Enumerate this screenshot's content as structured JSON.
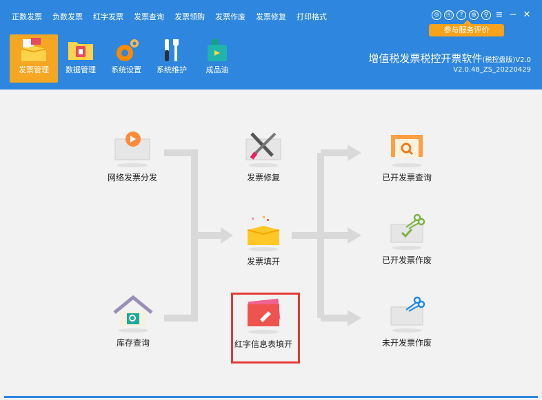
{
  "menu": [
    "正数发票",
    "负数发票",
    "红字发票",
    "发票查询",
    "发票领购",
    "发票作废",
    "发票修复",
    "打印格式"
  ],
  "window_controls": [
    "⊜",
    "ⓠ",
    "?",
    "⊕",
    "♀",
    "≡",
    "−",
    "✕"
  ],
  "feedback": "参与服务评价",
  "toolbar": [
    {
      "label": "发票管理",
      "icon": "invoice-box-icon"
    },
    {
      "label": "数据管理",
      "icon": "data-folder-icon"
    },
    {
      "label": "系统设置",
      "icon": "gear-icon"
    },
    {
      "label": "系统维护",
      "icon": "tools-icon"
    },
    {
      "label": "成品油",
      "icon": "oil-can-icon"
    }
  ],
  "app": {
    "title": "增值税发票税控开票软件",
    "edition": "(税控盘版)",
    "version_short": "V2.0",
    "version": "V2.0.48_ZS_20220429"
  },
  "flow": {
    "network_dispatch": "网络发票分发",
    "inventory_query": "库存查询",
    "invoice_repair": "发票修复",
    "invoice_issue": "发票填开",
    "red_info_fill": "红字信息表填开",
    "issued_query": "已开发票查询",
    "issued_void": "已开发票作废",
    "unissued_void": "未开发票作废"
  },
  "colors": {
    "header": "#2e86de",
    "active": "#f5a623",
    "badge": "#f7a21b",
    "highlight": "#e53935"
  }
}
